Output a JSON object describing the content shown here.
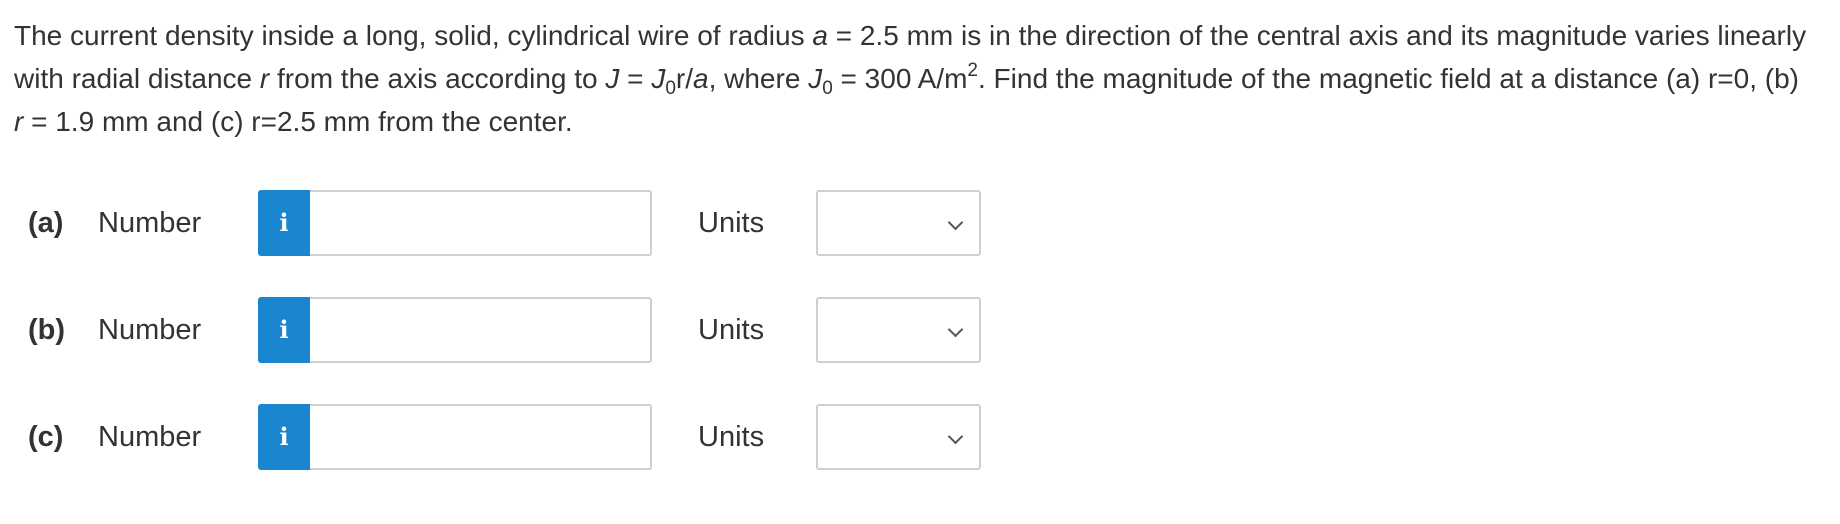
{
  "problem": {
    "seg1": "The current density inside a long, solid, cylindrical wire of radius ",
    "a_var": "a",
    "seg2": " = 2.5 mm is in the direction of the central axis and its magnitude varies linearly with radial distance ",
    "r_var": "r",
    "seg3": " from the axis according to ",
    "J_var": "J",
    "seg4": " = ",
    "J0_var": "J",
    "J0_sub": "0",
    "r_after": "r/",
    "a_var2": "a",
    "seg5": ", where ",
    "J0b_var": "J",
    "J0b_sub": "0",
    "seg6": " = 300 A/m",
    "sup2": "2",
    "seg7": ". Find the magnitude of the magnetic field at a distance (a) r=0, (b) ",
    "r_var2": "r",
    "seg8": " = 1.9 mm and (c) r=2.5 mm from the center."
  },
  "rows": [
    {
      "part": "(a)",
      "number_label": "Number",
      "info_icon": "i",
      "number_value": "",
      "units_label": "Units",
      "units_value": ""
    },
    {
      "part": "(b)",
      "number_label": "Number",
      "info_icon": "i",
      "number_value": "",
      "units_label": "Units",
      "units_value": ""
    },
    {
      "part": "(c)",
      "number_label": "Number",
      "info_icon": "i",
      "number_value": "",
      "units_label": "Units",
      "units_value": ""
    }
  ],
  "colors": {
    "info_button": "#1a86d0",
    "text": "#333333",
    "input_border": "#cfcfcf"
  }
}
